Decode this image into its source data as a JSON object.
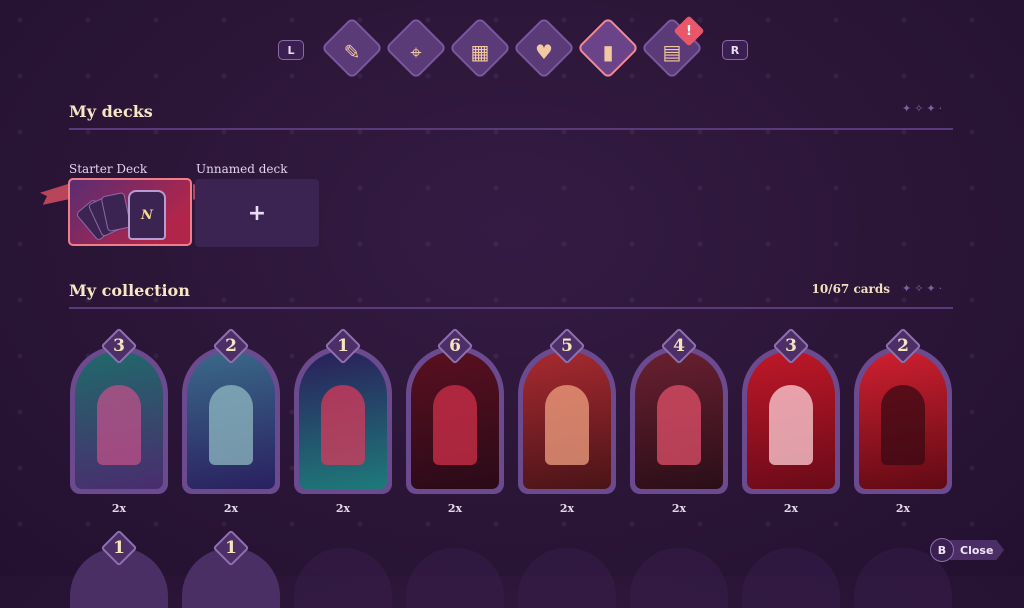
{
  "nav": {
    "left_key": "L",
    "right_key": "R",
    "tabs": [
      {
        "icon": "quill-icon",
        "glyph": "✎"
      },
      {
        "icon": "map-icon",
        "glyph": "⌖"
      },
      {
        "icon": "calendar-icon",
        "glyph": "▦"
      },
      {
        "icon": "heart-icon",
        "glyph": "♥"
      },
      {
        "icon": "cards-icon",
        "glyph": "▮"
      },
      {
        "icon": "book-icon",
        "glyph": "▤"
      }
    ],
    "active_index": 4,
    "alert_mark": "!"
  },
  "decks": {
    "title": "My decks",
    "items": [
      {
        "label": "Starter Deck",
        "emblem": "N"
      },
      {
        "label": "Unnamed deck",
        "add_symbol": "+"
      }
    ]
  },
  "collection": {
    "title": "My collection",
    "count": "10/67 cards",
    "cards": [
      {
        "count": "3",
        "copies": "2x",
        "theme": [
          "#1f6a6a",
          "#4a2c6e"
        ],
        "accent": "#c0508a"
      },
      {
        "count": "2",
        "copies": "2x",
        "theme": [
          "#3a6a8a",
          "#2a2060"
        ],
        "accent": "#8fb9c2"
      },
      {
        "count": "1",
        "copies": "2x",
        "theme": [
          "#2a1e5a",
          "#1e7a7a"
        ],
        "accent": "#d83a5a"
      },
      {
        "count": "6",
        "copies": "2x",
        "theme": [
          "#5a1020",
          "#2a0a18"
        ],
        "accent": "#d0304a"
      },
      {
        "count": "5",
        "copies": "2x",
        "theme": [
          "#a82a30",
          "#4a1418"
        ],
        "accent": "#f0a080"
      },
      {
        "count": "4",
        "copies": "2x",
        "theme": [
          "#6a2030",
          "#2a0e18"
        ],
        "accent": "#e0506a"
      },
      {
        "count": "3",
        "copies": "2x",
        "theme": [
          "#c01828",
          "#6a0a18"
        ],
        "accent": "#ffd0d8"
      },
      {
        "count": "2",
        "copies": "2x",
        "theme": [
          "#d02030",
          "#600a14"
        ],
        "accent": "#3a0a14"
      }
    ],
    "second_row": [
      {
        "count": "1"
      },
      {
        "count": "1"
      }
    ]
  },
  "close": {
    "key": "B",
    "label": "Close"
  }
}
